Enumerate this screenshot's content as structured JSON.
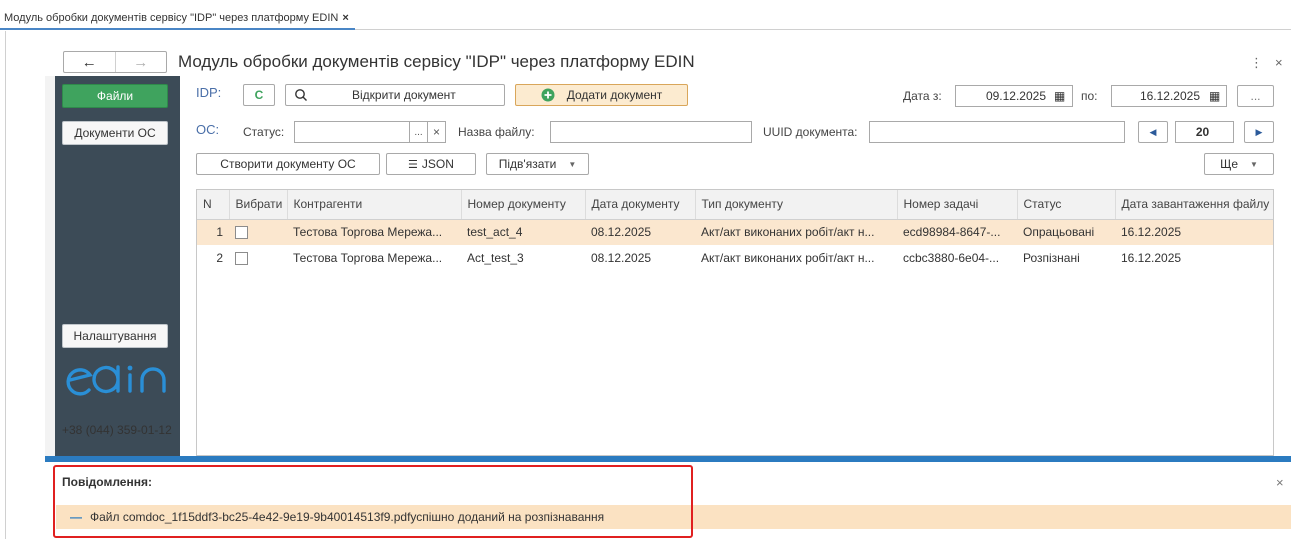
{
  "tab": {
    "label": "Модуль обробки документів сервісу \"IDP\" через платформу EDIN",
    "close": "×"
  },
  "window": {
    "title": "Модуль обробки документів сервісу \"IDP\" через платформу EDIN",
    "menu": "⋮",
    "close": "×"
  },
  "nav": {
    "back": "←",
    "forward": "→"
  },
  "sidebar": {
    "files": "Файли",
    "os_docs": "Документи ОС",
    "settings": "Налаштування",
    "logo": "edin",
    "phone": "+38 (044) 359-01-12"
  },
  "toolbar_idp": {
    "label": "IDP:",
    "refresh": "C",
    "open_doc": "Відкрити документ",
    "add_doc": "Додати документ",
    "date_from_label": "Дата з:",
    "date_from": "09.12.2025",
    "date_to_label": "по:",
    "date_to": "16.12.2025",
    "more": "..."
  },
  "toolbar_os": {
    "label": "ОС:",
    "status_label": "Статус:",
    "status_value": "",
    "filename_label": "Назва файлу:",
    "filename_value": "",
    "uuid_label": "UUID документа:",
    "uuid_value": "",
    "page_size": "20"
  },
  "actions": {
    "create_os": "Створити документу ОС",
    "json": "JSON",
    "link": "Підв'язати",
    "more": "Ще"
  },
  "table": {
    "columns": [
      "N",
      "Вибрати",
      "Контрагенти",
      "Номер документу",
      "Дата документу",
      "Тип документу",
      "Номер задачі",
      "Статус",
      "Дата завантаження файлу"
    ],
    "rows": [
      {
        "n": "1",
        "counterparty": "Тестова Торгова Мережа...",
        "doc_no": "test_act_4",
        "doc_date": "08.12.2025",
        "doc_type": "Акт/акт виконаних робіт/акт н...",
        "task_no": "ecd98984-8647-...",
        "status": "Опрацьовані",
        "upload_date": "16.12.2025"
      },
      {
        "n": "2",
        "counterparty": "Тестова Торгова Мережа...",
        "doc_no": "Act_test_3",
        "doc_date": "08.12.2025",
        "doc_type": "Акт/акт виконаних робіт/акт н...",
        "task_no": "ccbc3880-6e04-...",
        "status": "Розпізнані",
        "upload_date": "16.12.2025"
      }
    ]
  },
  "messages": {
    "title": "Повідомлення:",
    "close": "×",
    "items": [
      "Файл comdoc_1f15ddf3-bc25-4e42-9e19-9b40014513f9.pdfуспішно доданий на розпізнавання"
    ]
  },
  "colors": {
    "accent_green": "#3fa35e",
    "sidebar_dark": "#3c4b57",
    "highlight": "#fbe7cf",
    "message_bar": "#2b7bc0",
    "annotation_red": "#e02020"
  }
}
